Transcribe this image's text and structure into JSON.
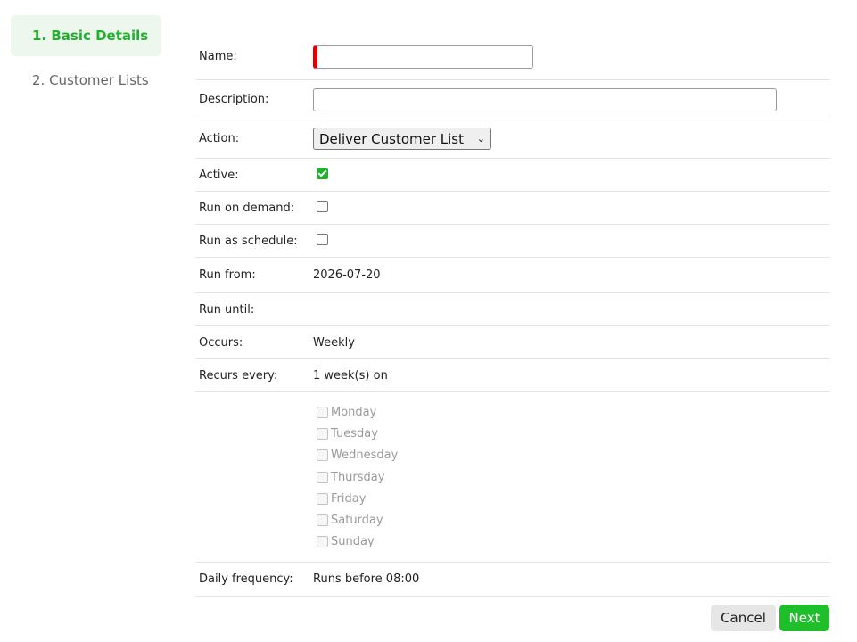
{
  "sidebar": {
    "steps": [
      {
        "label": "1. Basic Details"
      },
      {
        "label": "2. Customer Lists"
      }
    ]
  },
  "form": {
    "name": {
      "label": "Name:",
      "value": ""
    },
    "description": {
      "label": "Description:",
      "value": ""
    },
    "action": {
      "label": "Action:",
      "selected": "Deliver Customer List"
    },
    "active": {
      "label": "Active:",
      "checked": true
    },
    "run_on_demand": {
      "label": "Run on demand:",
      "checked": false
    },
    "run_as_schedule": {
      "label": "Run as schedule:",
      "checked": false
    },
    "run_from": {
      "label": "Run from:",
      "value": "2026-07-20"
    },
    "run_until": {
      "label": "Run until:",
      "value": ""
    },
    "occurs": {
      "label": "Occurs:",
      "value": "Weekly"
    },
    "recurs_every": {
      "label": "Recurs every:",
      "value": "1 week(s) on"
    },
    "days": [
      "Monday",
      "Tuesday",
      "Wednesday",
      "Thursday",
      "Friday",
      "Saturday",
      "Sunday"
    ],
    "daily_frequency": {
      "label": "Daily frequency:",
      "value": "Runs before 08:00"
    }
  },
  "footer": {
    "cancel_label": "Cancel",
    "next_label": "Next"
  },
  "colors": {
    "accent": "#1fb02e",
    "required": "#e00000"
  }
}
